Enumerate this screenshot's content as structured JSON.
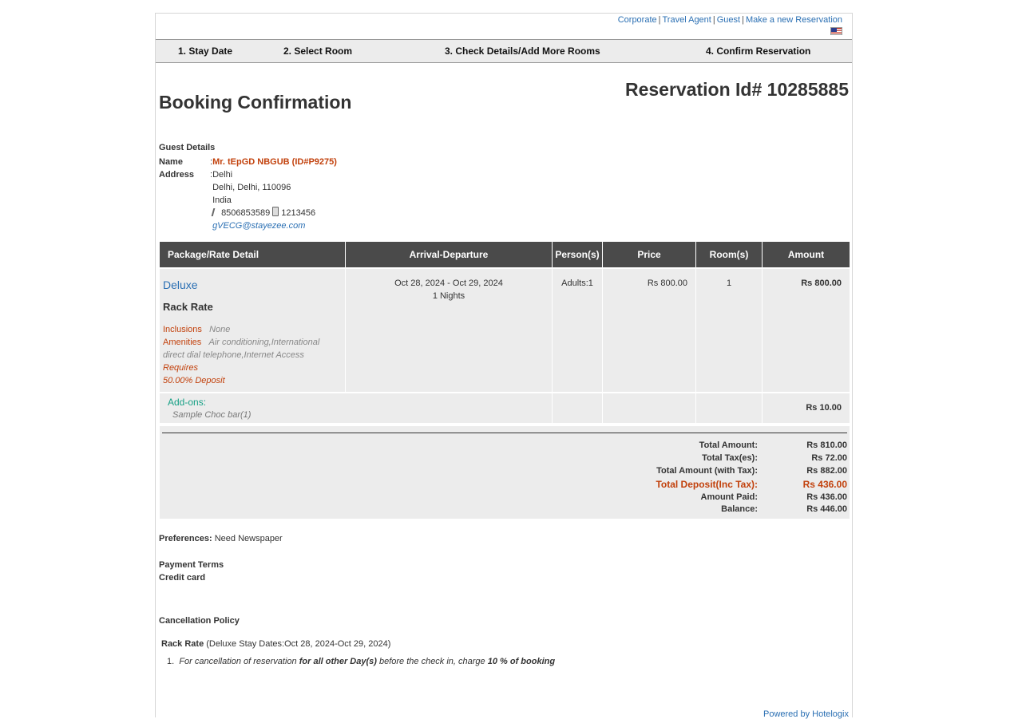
{
  "top_links": [
    "Corporate",
    "Travel Agent",
    "Guest",
    "Make a new Reservation"
  ],
  "steps": [
    "1. Stay Date",
    "2. Select Room",
    "3. Check Details/Add More Rooms",
    "4. Confirm Reservation"
  ],
  "page_title": "Booking Confirmation",
  "reservation_id": "Reservation Id# 10285885",
  "guest": {
    "header": "Guest Details",
    "name_label": "Name",
    "name": "Mr. tEpGD NBGUB (ID#P9275)",
    "address_label": "Address",
    "address_line1": "Delhi",
    "address_line2": "Delhi, Delhi, 110096",
    "address_line3": "India",
    "phone": "8506853589",
    "mobile": "1213456",
    "email": "gVECG@stayezee.com"
  },
  "table": {
    "headers": [
      "Package/Rate Detail",
      "Arrival-Departure",
      "Person(s)",
      "Price",
      "Room(s)",
      "Amount"
    ],
    "room": {
      "name": "Deluxe",
      "rate": "Rack Rate",
      "inclusions_label": "Inclusions",
      "inclusions": "None",
      "amenities_label": "Amenities",
      "amenities": "Air conditioning,International direct dial telephone,Internet Access",
      "requires": "Requires",
      "deposit": "50.00% Deposit",
      "dates": "Oct 28, 2024 - Oct 29, 2024",
      "nights": "1 Nights",
      "persons": "Adults:1",
      "price": "Rs 800.00",
      "rooms": "1",
      "amount": "Rs 800.00"
    },
    "addons": {
      "title": "Add-ons:",
      "item": "Sample Choc bar(1)",
      "amount": "Rs 10.00"
    }
  },
  "totals": [
    {
      "label": "Total Amount:",
      "value": "Rs 810.00"
    },
    {
      "label": "Total Tax(es):",
      "value": "Rs 72.00"
    },
    {
      "label": "Total Amount (with Tax):",
      "value": "Rs 882.00"
    },
    {
      "label": "Total Deposit(Inc Tax):",
      "value": "Rs 436.00"
    },
    {
      "label": "Amount Paid:",
      "value": "Rs 436.00"
    },
    {
      "label": "Balance:",
      "value": "Rs 446.00"
    }
  ],
  "preferences_label": "Preferences:",
  "preferences": "Need Newspaper",
  "payment_terms_label": "Payment Terms",
  "payment_terms": "Credit card",
  "cancellation_label": "Cancellation Policy",
  "cancellation_rate": "Rack Rate",
  "cancellation_dates": "(Deluxe Stay Dates:Oct 28, 2024-Oct 29, 2024)",
  "policy": {
    "num": "1.",
    "part1": "For cancellation of reservation ",
    "part2": "for all other Day(s)",
    "part3": " before the check in, charge ",
    "part4": "10 % of booking"
  },
  "powered_by": "Powered by Hotelogix"
}
